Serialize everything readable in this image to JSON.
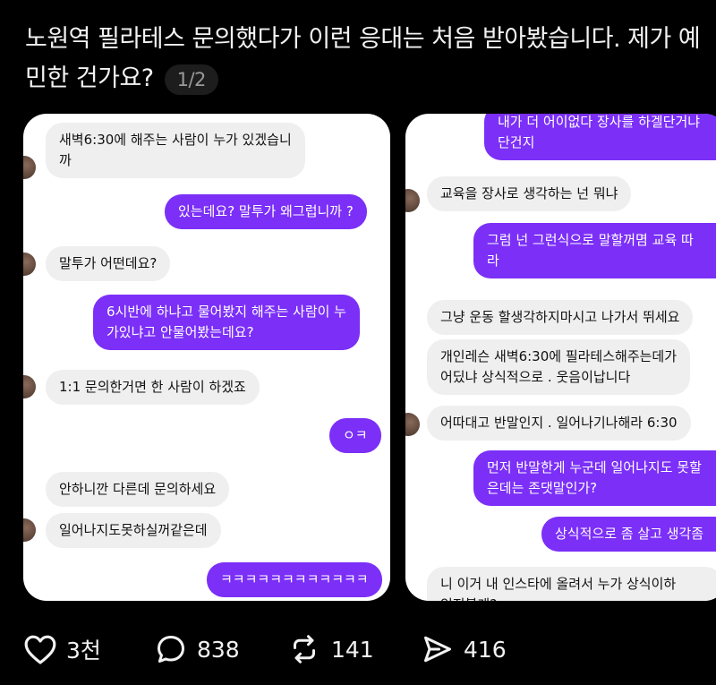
{
  "post": {
    "title": "노원역 필라테스 문의했다가 이런 응대는 처음 받아봤습니다. 제가 예민한 건가요?",
    "page_indicator": "1/2"
  },
  "chat1": {
    "messages": [
      {
        "side": "in",
        "text": "새벽6:30에 해주는 사람이 누가 있겠습니\n까"
      },
      {
        "side": "out",
        "text": "있는데요? 말투가 왜그럽니까 ?"
      },
      {
        "side": "in",
        "text": "말투가 어떤데요?"
      },
      {
        "side": "out",
        "text": "6시반에 하냐고 물어봤지 해주는 사람이 누\n가있냐고 안물어봤는데요?"
      },
      {
        "side": "in",
        "text": "1:1 문의한거면 한 사람이 하겠죠"
      },
      {
        "side": "out",
        "text": "ㅇㅋ"
      },
      {
        "side": "in",
        "text": "안하니깐 다른데 문의하세요"
      },
      {
        "side": "in",
        "text": "일어나지도못하실꺼같은데"
      },
      {
        "side": "out",
        "text": "ㅋㅋㅋㅋㅋㅋㅋㅋㅋㅋㅋㅋ"
      }
    ]
  },
  "chat2": {
    "messages": [
      {
        "side": "out",
        "text": "내가 더 어이없다 장사를 하겔단거냐\n단건지"
      },
      {
        "side": "in",
        "text": "교육을 장사로 생각하는 넌 뭐냐"
      },
      {
        "side": "out",
        "text": "그럼 넌 그런식으로 말할꺼몀 교육 따\n라"
      },
      {
        "side": "in",
        "text": "그냥 운동 할생각하지마시고 나가서 뛰세요"
      },
      {
        "side": "in",
        "text": "개인레슨 새벽6:30에 필라테스해주는데가\n어딨냐 상식적으로 . 웃음이납니다"
      },
      {
        "side": "in",
        "text": "어따대고 반말인지 . 일어나기나해라 6:30"
      },
      {
        "side": "out",
        "text": "먼저 반말한게 누군데 일어나지도 못할\n은데는 존댓말인가?"
      },
      {
        "side": "out",
        "text": "상식적으로 좀 살고 생각좀"
      },
      {
        "side": "in",
        "text": "니 이거 내 인스타에 올려서 누가 상식이하\n인지볼게?"
      }
    ]
  },
  "stats": {
    "likes": "3천",
    "comments": "838",
    "reposts": "141",
    "shares": "416"
  },
  "colors": {
    "background": "#000000",
    "outgoing_bubble": "#7b2ff7",
    "incoming_bubble": "#efefef"
  }
}
